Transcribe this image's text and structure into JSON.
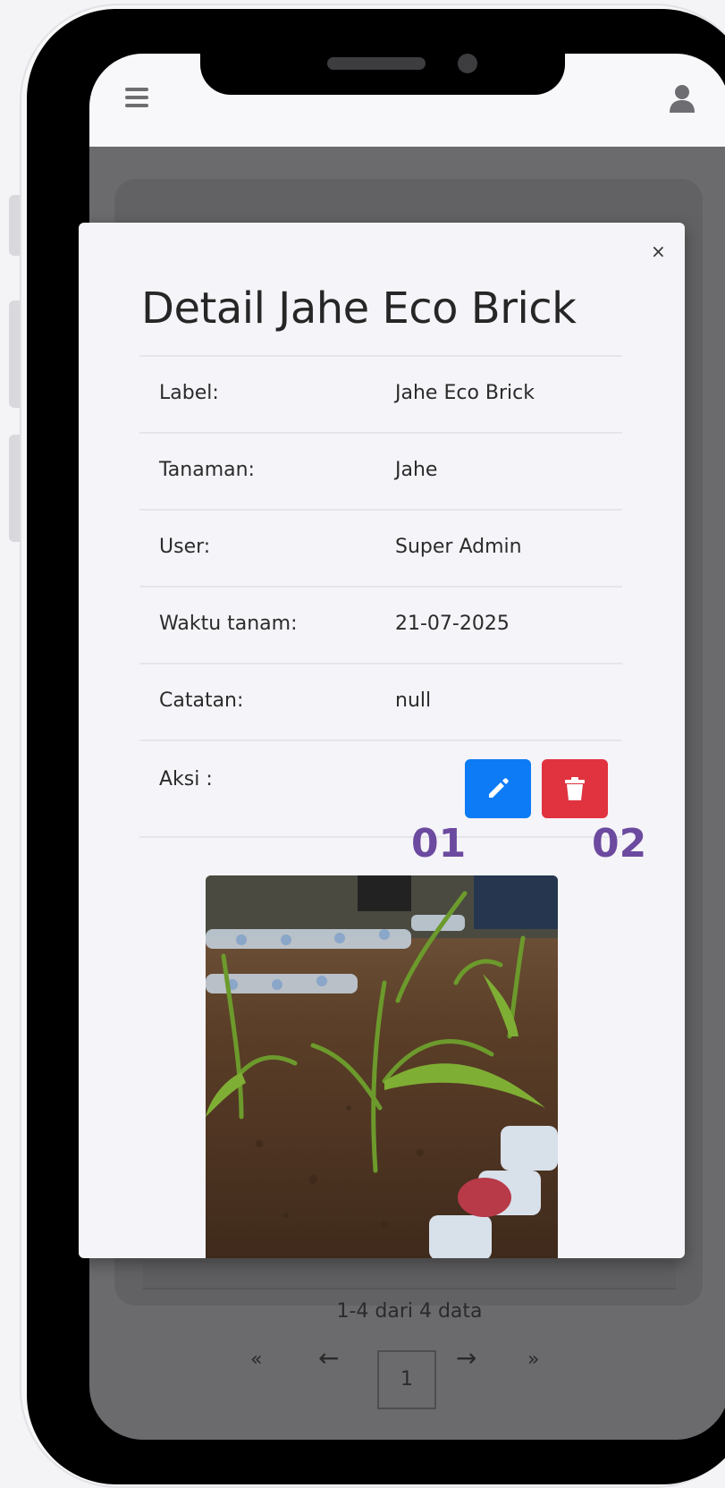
{
  "header": {
    "menu_icon": "hamburger-icon",
    "user_icon": "user-icon"
  },
  "background": {
    "pagination_info": "1-4 dari 4 data",
    "first_label": "«",
    "prev_label": "←",
    "current_page": "1",
    "next_label": "→",
    "last_label": "»"
  },
  "modal": {
    "close_label": "×",
    "title": "Detail Jahe Eco Brick",
    "rows": [
      {
        "key": "Label:",
        "value": "Jahe Eco Brick"
      },
      {
        "key": "Tanaman:",
        "value": "Jahe"
      },
      {
        "key": "User:",
        "value": "Super Admin"
      },
      {
        "key": "Waktu tanam:",
        "value": "21-07-2025"
      },
      {
        "key": "Catatan:",
        "value": "null"
      }
    ],
    "actions_label": "Aksi :",
    "edit_icon": "pencil-icon",
    "delete_icon": "trash-icon"
  },
  "annotations": {
    "edit_number": "01",
    "delete_number": "02"
  },
  "colors": {
    "edit_button": "#0d7bf5",
    "delete_button": "#e0323f",
    "annotation": "#6c4a9f"
  }
}
